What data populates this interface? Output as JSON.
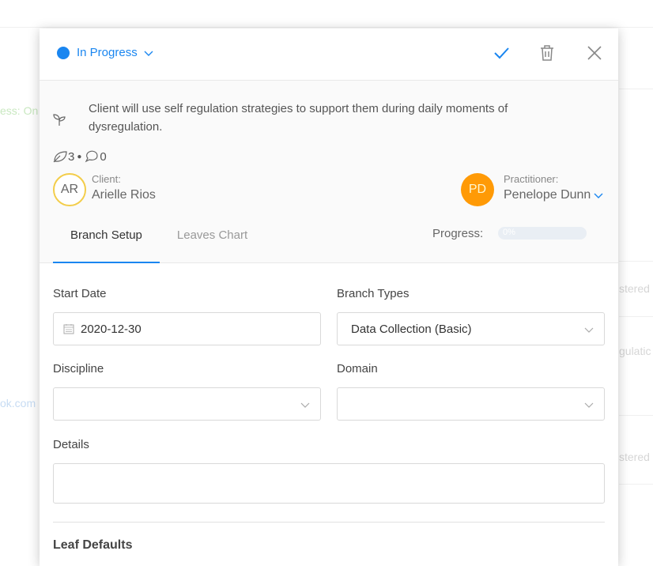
{
  "status": {
    "label": "In Progress",
    "color": "#1a86f0"
  },
  "header_actions": {
    "confirm_icon": "check-icon",
    "delete_icon": "trash-icon",
    "close_icon": "close-icon"
  },
  "goal": {
    "text": "Client will use self regulation strategies to support them during daily moments of dysregulation.",
    "leaves_count": "3",
    "separator": "●",
    "comments_count": "0"
  },
  "client": {
    "role": "Client:",
    "name": "Arielle Rios",
    "initials": "AR"
  },
  "practitioner": {
    "role": "Practitioner:",
    "name": "Penelope Dunn",
    "initials": "PD",
    "color": "#ff9a06"
  },
  "tabs": [
    {
      "label": "Branch Setup",
      "active": true
    },
    {
      "label": "Leaves Chart",
      "active": false
    }
  ],
  "progress": {
    "label": "Progress:",
    "value": 0,
    "text": "0%"
  },
  "form": {
    "start_date": {
      "label": "Start Date",
      "value": "2020-12-30"
    },
    "branch_types": {
      "label": "Branch Types",
      "value": "Data Collection (Basic)"
    },
    "discipline": {
      "label": "Discipline",
      "value": ""
    },
    "domain": {
      "label": "Domain",
      "value": ""
    },
    "details": {
      "label": "Details",
      "value": ""
    }
  },
  "leaf_defaults": {
    "title": "Leaf Defaults"
  },
  "background": {
    "left_status": "ess: On",
    "left_email": "ok.com",
    "right_1": "stered I",
    "right_2": "gulatic",
    "right_3": "stered I"
  }
}
